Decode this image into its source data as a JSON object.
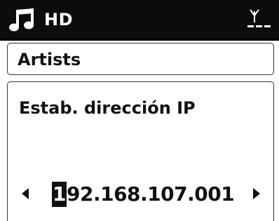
{
  "status_bar": {
    "source": "HD",
    "icons": {
      "source_icon": "music-note-icon",
      "signal_icon": "wifi-signal-icon"
    }
  },
  "header": {
    "title": "Artists"
  },
  "setting": {
    "title": "Estab. dirección IP",
    "ip_address": {
      "cursor_char": "1",
      "rest": "92.168.107.001"
    },
    "icons": {
      "prev": "left-arrow-icon",
      "next": "right-arrow-icon"
    }
  },
  "colors": {
    "status_bar_bg": "#0c0c0c",
    "text": "#111111",
    "background": "#ffffff",
    "cursor_bg": "#111111"
  }
}
